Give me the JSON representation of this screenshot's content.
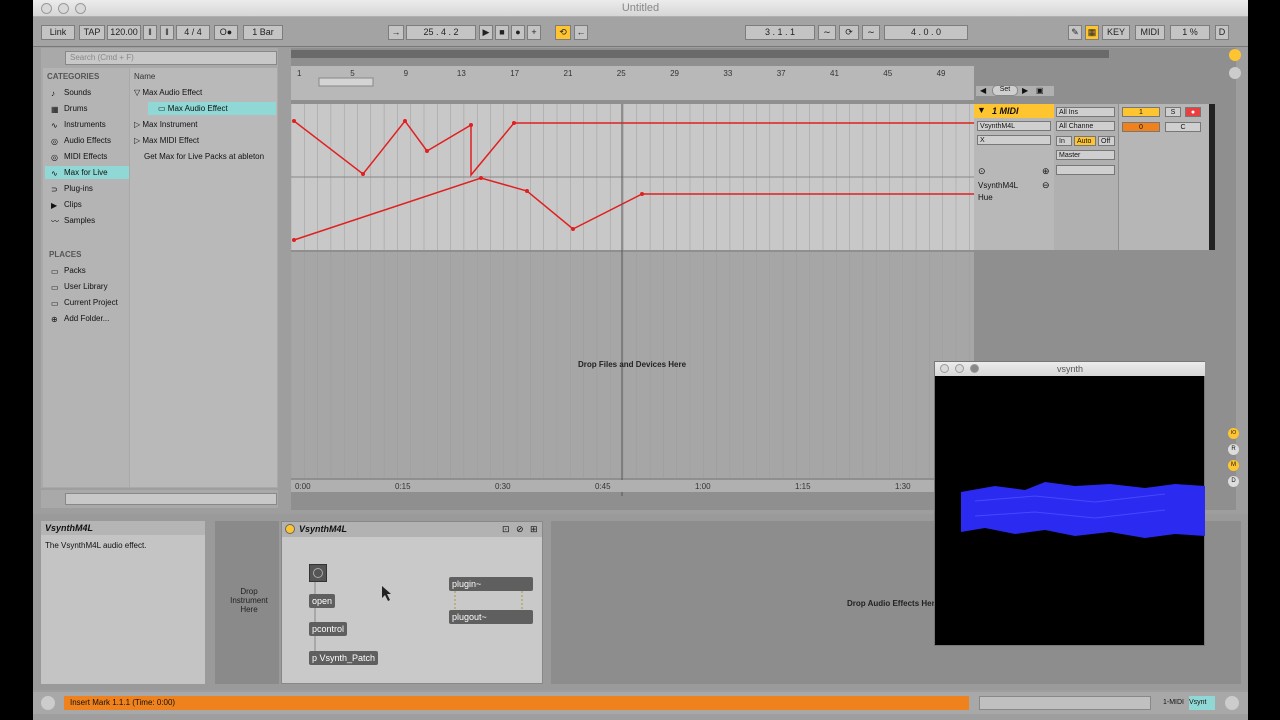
{
  "window": {
    "title": "Untitled"
  },
  "control_bar": {
    "link": "Link",
    "tap": "TAP",
    "tempo": "120.00",
    "meter": "4 / 4",
    "quant": "1 Bar",
    "position": "25 .   4 .   2",
    "loop_start": "3 .   1 .   1",
    "loop_length": "4 .   0 .   0",
    "key": "KEY",
    "midi": "MIDI",
    "cpu": "1 %",
    "d": "D"
  },
  "browser": {
    "search_placeholder": "Search (Cmd + F)",
    "categories_header": "CATEGORIES",
    "categories": [
      "Sounds",
      "Drums",
      "Instruments",
      "Audio Effects",
      "MIDI Effects",
      "Max for Live",
      "Plug-ins",
      "Clips",
      "Samples"
    ],
    "places_header": "PLACES",
    "places": [
      "Packs",
      "User Library",
      "Current Project",
      "Add Folder..."
    ],
    "name_header": "Name",
    "files": [
      "Max Audio Effect",
      "Max Audio Effect",
      "Max Instrument",
      "Max MIDI Effect",
      "Get Max for Live Packs at ableton"
    ]
  },
  "ruler": {
    "bars": [
      "1",
      "5",
      "9",
      "13",
      "17",
      "21",
      "25",
      "29",
      "33",
      "37",
      "41",
      "45",
      "49"
    ],
    "times": [
      "0:00",
      "0:15",
      "0:30",
      "0:45",
      "1:00",
      "1:15",
      "1:30"
    ]
  },
  "arrangement": {
    "drop_text": "Drop Files and Devices Here"
  },
  "track": {
    "name": "1 MIDI",
    "device": "VsynthM4L",
    "param": "X",
    "lane_device": "VsynthM4L",
    "lane_param": "Hue",
    "input": "All Ins",
    "channel": "All Channe",
    "monitor_in": "In",
    "monitor_auto": "Auto",
    "monitor_off": "Off",
    "output": "Master",
    "number": "1",
    "solo": "S",
    "volume": "0",
    "pan": "C",
    "set_label": "Set"
  },
  "detail": {
    "info_title": "VsynthM4L",
    "info_text": "The VsynthM4L audio effect.",
    "drop_instrument": "Drop Instrument Here",
    "device_title": "VsynthM4L",
    "objects": {
      "open": "open",
      "pcontrol": "pcontrol",
      "patch": "p Vsynth_Patch",
      "plugin": "plugin~",
      "plugout": "plugout~"
    },
    "drop_audio": "Drop Audio Effects Here"
  },
  "vsynth": {
    "title": "vsynth"
  },
  "status": {
    "message": "Insert Mark 1.1.1 (Time: 0:00)",
    "track_label": "1-MIDI",
    "track_device": "Vsynt"
  },
  "colors": {
    "accent": "#ffc531",
    "automation": "#e02020",
    "orange": "#f0821e",
    "browser_select": "#8fd8d6",
    "vsynth_blue": "#2a2af0"
  }
}
